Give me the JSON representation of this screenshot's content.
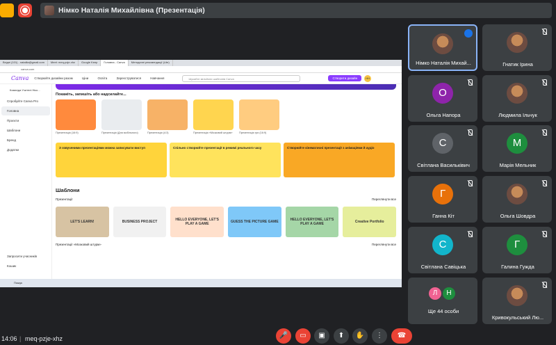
{
  "header": {
    "presenter_label": "Німко Наталія Михайлівна (Презентація)"
  },
  "shared_screen": {
    "browser_tabs": [
      "Вхідні (101) - nataliia@gmail.com",
      "Meet: meq-pzje-xhz",
      "Google Keep",
      "Головна - Canva",
      "Методичні рекомендації (Lite)"
    ],
    "address": "canva.com",
    "canva": {
      "logo": "Canva",
      "nav": [
        "Створюйте дизайни разом",
        "Ціни",
        "Освіта",
        "Зареєструватися",
        "Навчання"
      ],
      "search_placeholder": "Шукайте мільйони шаблонів Canva",
      "create_button": "Створити дизайн",
      "user_initials": "НН",
      "team": "Команда Учителі Ніко...",
      "try_pro": "Спробуйте Canva Pro",
      "sidebar": [
        "Головна",
        "Проєкти",
        "Шаблони",
        "Бренд",
        "Додатки"
      ],
      "sidebar_bottom": [
        "Запросити учасників",
        "Кошик"
      ],
      "row_title": "Покажіть, запишіть або надсилайте...",
      "thumbs": [
        "Презентація (16:9)",
        "Презентація (Для мобільного)",
        "Презентація (4:3)",
        "Презентація «Мозковий штурм»",
        "Презентація гри (16:9)"
      ],
      "banners": [
        "З озвученими презентаціями можна записувати виступ",
        "Спільно створюйте презентації в режимі реального часу",
        "Створюйте кінематичні презентації з анімаціями й аудіо"
      ],
      "section": "Шаблони",
      "subsection": "Презентації",
      "subsection2": "Презентації «Мозковий штурм»",
      "see_all": "Переглянути все",
      "templates": [
        "LET'S LEARN!",
        "BUSINESS PROJECT",
        "HELLO EVERYONE, LET'S PLAY A GAME",
        "GUESS THE PICTURE GAME",
        "HELLO EVERYONE, LET'S PLAY A GAME",
        "Creative Portfolio"
      ]
    },
    "taskbar": "Пошук"
  },
  "participants": [
    {
      "name": "Німко Наталія Михай...",
      "initial": "",
      "speaking": true
    },
    {
      "name": "Гнатик Ірина",
      "initial": ""
    },
    {
      "name": "Ольга Напора",
      "initial": "О",
      "color": "#8e24aa"
    },
    {
      "name": "Людмила Ільчук",
      "initial": ""
    },
    {
      "name": "Світлана Васильківич",
      "initial": "С",
      "color": "#5f6368"
    },
    {
      "name": "Марія Мельник",
      "initial": "М",
      "color": "#1e8e3e"
    },
    {
      "name": "Ганна Кіт",
      "initial": "Г",
      "color": "#e8710a"
    },
    {
      "name": "Ольга Шовдра",
      "initial": ""
    },
    {
      "name": "Світлана Савіцька",
      "initial": "С",
      "color": "#12b5cb"
    },
    {
      "name": "Галина Гужда",
      "initial": "Г",
      "color": "#1e8e3e"
    },
    {
      "name": "Ще 44 особи",
      "initial": ""
    },
    {
      "name": "Кривокульський Лю...",
      "initial": ""
    }
  ],
  "footer": {
    "time": "14:06",
    "separator": "|",
    "meeting_code": "meq-pzje-xhz"
  },
  "colors": {
    "accent": "#8ab4f8",
    "danger": "#ea4335",
    "tile_bg": "#3c4043",
    "canva_purple": "#8b3dff"
  }
}
